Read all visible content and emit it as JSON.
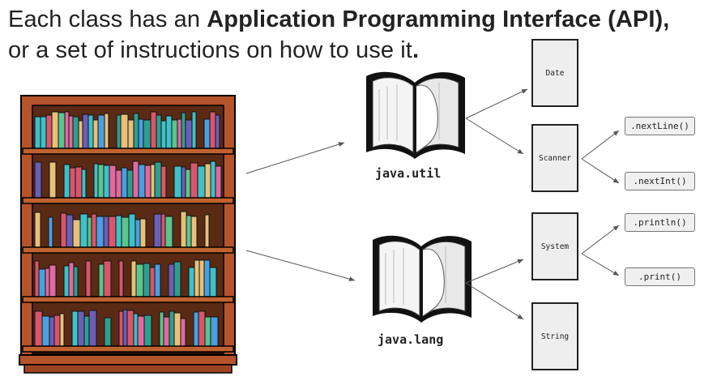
{
  "heading": {
    "line1_prefix": "Each class has an ",
    "line1_bold": "Application Programming Interface (API),",
    "line2_text": "or a set of instructions on how to use it",
    "line2_bold": "."
  },
  "packages": [
    {
      "id": "util",
      "label": "java.util"
    },
    {
      "id": "lang",
      "label": "java.lang"
    }
  ],
  "classes": [
    {
      "id": "date",
      "label": "Date"
    },
    {
      "id": "scanner",
      "label": "Scanner"
    },
    {
      "id": "system",
      "label": "System"
    },
    {
      "id": "string",
      "label": "String"
    }
  ],
  "methods": [
    {
      "id": "nextline",
      "label": ".nextLine()"
    },
    {
      "id": "nextint",
      "label": ".nextInt()"
    },
    {
      "id": "println",
      "label": ".println()"
    },
    {
      "id": "print",
      "label": ".print()"
    }
  ],
  "colors": {
    "bookcase_wood": "#b5532a",
    "bookcase_back": "#5a2a14",
    "book_palette": [
      "#3fc1c9",
      "#6b5fb5",
      "#d8566b",
      "#e8c07a",
      "#5cc48d",
      "#2f9e8f",
      "#4a9fe0",
      "#e06aa0"
    ],
    "arrow": "#555555",
    "class_fill": "#eeeeee",
    "method_fill": "#f0f0f0"
  }
}
